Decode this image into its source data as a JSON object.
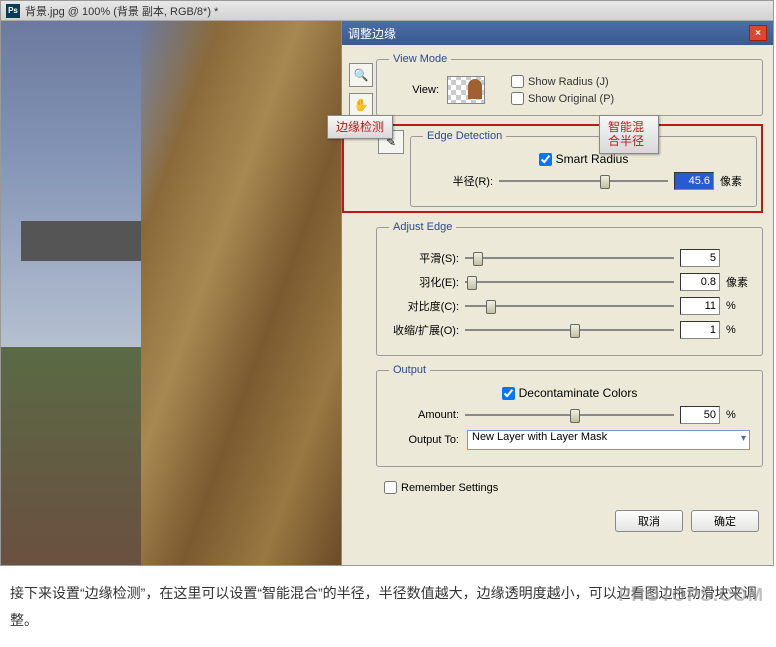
{
  "titlebar": "背景.jpg @ 100% (背景 副本, RGB/8*) *",
  "dialog": {
    "title": "调整边缘",
    "viewMode": {
      "legend": "View Mode",
      "viewLabel": "View:",
      "showRadius": "Show Radius (J)",
      "showOriginal": "Show Original (P)"
    },
    "edgeDetection": {
      "legend": "Edge Detection",
      "smartRadius": "Smart Radius",
      "radiusLabel": "半径(R):",
      "radiusValue": "45.6",
      "radiusUnit": "像素"
    },
    "adjustEdge": {
      "legend": "Adjust Edge",
      "smoothLabel": "平滑(S):",
      "smoothValue": "5",
      "featherLabel": "羽化(E):",
      "featherValue": "0.8",
      "featherUnit": "像素",
      "contrastLabel": "对比度(C):",
      "contrastValue": "11",
      "contrastUnit": "%",
      "shiftLabel": "收缩/扩展(O):",
      "shiftValue": "1",
      "shiftUnit": "%"
    },
    "output": {
      "legend": "Output",
      "decontaminate": "Decontaminate Colors",
      "amountLabel": "Amount:",
      "amountValue": "50",
      "amountUnit": "%",
      "outputToLabel": "Output To:",
      "outputToValue": "New Layer with Layer Mask"
    },
    "remember": "Remember Settings",
    "cancel": "取消",
    "ok": "确定"
  },
  "annotations": {
    "edge": "边缘检测",
    "smartMix": "智能混合半径"
  },
  "caption": "接下来设置“边缘检测”，在这里可以设置“智能混合”的半径，半径数值越大，边缘透明度越小，可以边看图边拖动滑块来调整。",
  "watermark": "PHOTOPS.COM"
}
